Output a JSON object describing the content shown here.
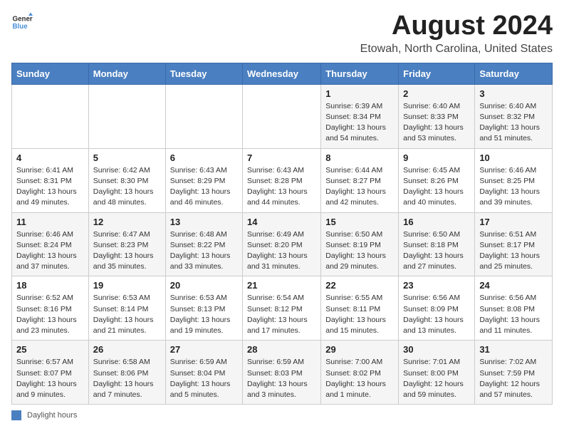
{
  "logo": {
    "text_general": "General",
    "text_blue": "Blue"
  },
  "title": {
    "month_year": "August 2024",
    "location": "Etowah, North Carolina, United States"
  },
  "weekdays": [
    "Sunday",
    "Monday",
    "Tuesday",
    "Wednesday",
    "Thursday",
    "Friday",
    "Saturday"
  ],
  "weeks": [
    [
      {
        "day": "",
        "info": ""
      },
      {
        "day": "",
        "info": ""
      },
      {
        "day": "",
        "info": ""
      },
      {
        "day": "",
        "info": ""
      },
      {
        "day": "1",
        "info": "Sunrise: 6:39 AM\nSunset: 8:34 PM\nDaylight: 13 hours and 54 minutes."
      },
      {
        "day": "2",
        "info": "Sunrise: 6:40 AM\nSunset: 8:33 PM\nDaylight: 13 hours and 53 minutes."
      },
      {
        "day": "3",
        "info": "Sunrise: 6:40 AM\nSunset: 8:32 PM\nDaylight: 13 hours and 51 minutes."
      }
    ],
    [
      {
        "day": "4",
        "info": "Sunrise: 6:41 AM\nSunset: 8:31 PM\nDaylight: 13 hours and 49 minutes."
      },
      {
        "day": "5",
        "info": "Sunrise: 6:42 AM\nSunset: 8:30 PM\nDaylight: 13 hours and 48 minutes."
      },
      {
        "day": "6",
        "info": "Sunrise: 6:43 AM\nSunset: 8:29 PM\nDaylight: 13 hours and 46 minutes."
      },
      {
        "day": "7",
        "info": "Sunrise: 6:43 AM\nSunset: 8:28 PM\nDaylight: 13 hours and 44 minutes."
      },
      {
        "day": "8",
        "info": "Sunrise: 6:44 AM\nSunset: 8:27 PM\nDaylight: 13 hours and 42 minutes."
      },
      {
        "day": "9",
        "info": "Sunrise: 6:45 AM\nSunset: 8:26 PM\nDaylight: 13 hours and 40 minutes."
      },
      {
        "day": "10",
        "info": "Sunrise: 6:46 AM\nSunset: 8:25 PM\nDaylight: 13 hours and 39 minutes."
      }
    ],
    [
      {
        "day": "11",
        "info": "Sunrise: 6:46 AM\nSunset: 8:24 PM\nDaylight: 13 hours and 37 minutes."
      },
      {
        "day": "12",
        "info": "Sunrise: 6:47 AM\nSunset: 8:23 PM\nDaylight: 13 hours and 35 minutes."
      },
      {
        "day": "13",
        "info": "Sunrise: 6:48 AM\nSunset: 8:22 PM\nDaylight: 13 hours and 33 minutes."
      },
      {
        "day": "14",
        "info": "Sunrise: 6:49 AM\nSunset: 8:20 PM\nDaylight: 13 hours and 31 minutes."
      },
      {
        "day": "15",
        "info": "Sunrise: 6:50 AM\nSunset: 8:19 PM\nDaylight: 13 hours and 29 minutes."
      },
      {
        "day": "16",
        "info": "Sunrise: 6:50 AM\nSunset: 8:18 PM\nDaylight: 13 hours and 27 minutes."
      },
      {
        "day": "17",
        "info": "Sunrise: 6:51 AM\nSunset: 8:17 PM\nDaylight: 13 hours and 25 minutes."
      }
    ],
    [
      {
        "day": "18",
        "info": "Sunrise: 6:52 AM\nSunset: 8:16 PM\nDaylight: 13 hours and 23 minutes."
      },
      {
        "day": "19",
        "info": "Sunrise: 6:53 AM\nSunset: 8:14 PM\nDaylight: 13 hours and 21 minutes."
      },
      {
        "day": "20",
        "info": "Sunrise: 6:53 AM\nSunset: 8:13 PM\nDaylight: 13 hours and 19 minutes."
      },
      {
        "day": "21",
        "info": "Sunrise: 6:54 AM\nSunset: 8:12 PM\nDaylight: 13 hours and 17 minutes."
      },
      {
        "day": "22",
        "info": "Sunrise: 6:55 AM\nSunset: 8:11 PM\nDaylight: 13 hours and 15 minutes."
      },
      {
        "day": "23",
        "info": "Sunrise: 6:56 AM\nSunset: 8:09 PM\nDaylight: 13 hours and 13 minutes."
      },
      {
        "day": "24",
        "info": "Sunrise: 6:56 AM\nSunset: 8:08 PM\nDaylight: 13 hours and 11 minutes."
      }
    ],
    [
      {
        "day": "25",
        "info": "Sunrise: 6:57 AM\nSunset: 8:07 PM\nDaylight: 13 hours and 9 minutes."
      },
      {
        "day": "26",
        "info": "Sunrise: 6:58 AM\nSunset: 8:06 PM\nDaylight: 13 hours and 7 minutes."
      },
      {
        "day": "27",
        "info": "Sunrise: 6:59 AM\nSunset: 8:04 PM\nDaylight: 13 hours and 5 minutes."
      },
      {
        "day": "28",
        "info": "Sunrise: 6:59 AM\nSunset: 8:03 PM\nDaylight: 13 hours and 3 minutes."
      },
      {
        "day": "29",
        "info": "Sunrise: 7:00 AM\nSunset: 8:02 PM\nDaylight: 13 hours and 1 minute."
      },
      {
        "day": "30",
        "info": "Sunrise: 7:01 AM\nSunset: 8:00 PM\nDaylight: 12 hours and 59 minutes."
      },
      {
        "day": "31",
        "info": "Sunrise: 7:02 AM\nSunset: 7:59 PM\nDaylight: 12 hours and 57 minutes."
      }
    ]
  ],
  "legend": {
    "label": "Daylight hours"
  }
}
